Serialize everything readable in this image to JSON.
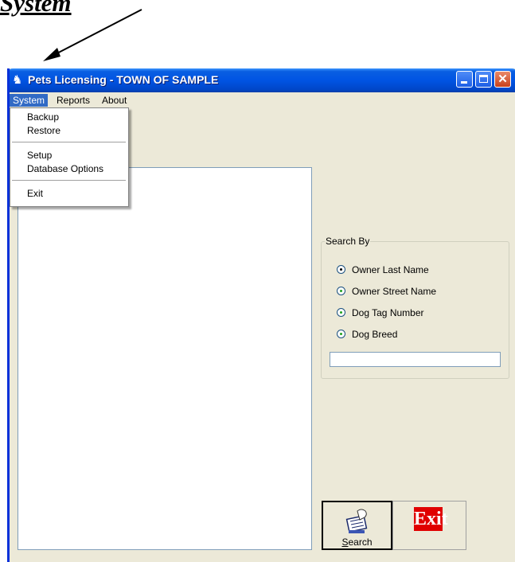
{
  "annotation": {
    "label": "System"
  },
  "window": {
    "title": "Pets Licensing - TOWN OF SAMPLE"
  },
  "menubar": {
    "system": "System",
    "reports": "Reports",
    "about": "About"
  },
  "system_menu": {
    "backup": "Backup",
    "restore": "Restore",
    "setup": "Setup",
    "database_options": "Database Options",
    "exit": "Exit"
  },
  "search_by": {
    "legend": "Search By",
    "selected": "Owner Last Name",
    "options": [
      "Owner Last Name",
      "Owner Street Name",
      "Dog Tag Number",
      "Dog Breed"
    ],
    "input_value": ""
  },
  "buttons": {
    "search_label": "Search",
    "search_mnemonic": "S",
    "search_rest": "earch",
    "exit_label": "Exit"
  },
  "icons": {
    "app": "dog-icon",
    "search": "search-hand-icon"
  },
  "colors": {
    "titlebar": "#0054e3",
    "menu_highlight": "#316ac5",
    "exit_red": "#e00000"
  }
}
